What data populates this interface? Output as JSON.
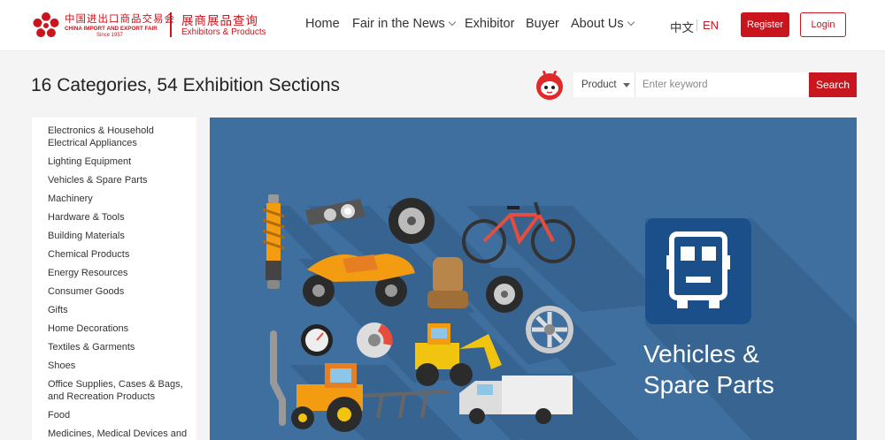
{
  "header": {
    "logo": {
      "cn": "中国进出口商品交易会",
      "en": "CHINA IMPORT AND EXPORT FAIR",
      "since": "Since 1957",
      "title": "展商展品查询",
      "subtitle": "Exhibitors & Products"
    },
    "nav": [
      {
        "label": "Home",
        "has_dropdown": false
      },
      {
        "label": "Fair in the News",
        "has_dropdown": true
      },
      {
        "label": "Exhibitor",
        "has_dropdown": false
      },
      {
        "label": "Buyer",
        "has_dropdown": false
      },
      {
        "label": "About Us",
        "has_dropdown": true
      }
    ],
    "lang_cn": "中文",
    "lang_en": "EN",
    "register_label": "Register",
    "login_label": "Login"
  },
  "page_title": "16 Categories, 54 Exhibition Sections",
  "search": {
    "type_selected": "Product",
    "placeholder": "Enter keyword",
    "button_label": "Search"
  },
  "categories": [
    "Electronics & Household Electrical Appliances",
    "Lighting Equipment",
    "Vehicles & Spare Parts",
    "Machinery",
    "Hardware & Tools",
    "Building Materials",
    "Chemical Products",
    "Energy Resources",
    "Consumer Goods",
    "Gifts",
    "Home Decorations",
    "Textiles & Garments",
    "Shoes",
    "Office Supplies, Cases & Bags, and Recreation Products",
    "Food",
    "Medicines, Medical Devices and"
  ],
  "banner": {
    "title": "Vehicles &\nSpare Parts",
    "background_color": "#3f6f9f",
    "icon": "truck-icon"
  },
  "colors": {
    "brand_red": "#c9151e",
    "banner_blue": "#3f6f9f"
  }
}
